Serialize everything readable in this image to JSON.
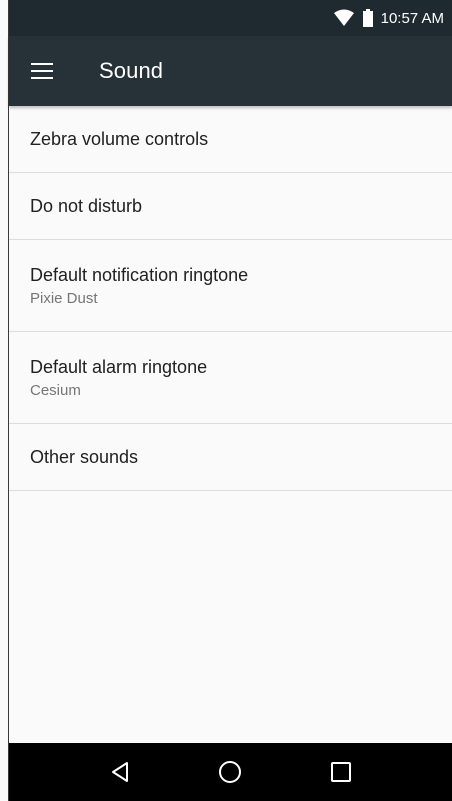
{
  "status_bar": {
    "time": "10:57 AM",
    "icons": [
      "wifi-icon",
      "battery-icon"
    ]
  },
  "toolbar": {
    "menu_icon": "menu-icon",
    "title": "Sound"
  },
  "items": [
    {
      "title": "Zebra volume controls",
      "summary": ""
    },
    {
      "title": "Do not disturb",
      "summary": ""
    },
    {
      "title": "Default notification ringtone",
      "summary": "Pixie Dust"
    },
    {
      "title": "Default alarm ringtone",
      "summary": "Cesium"
    },
    {
      "title": "Other sounds",
      "summary": ""
    }
  ],
  "nav_bar": {
    "icons": [
      "back-icon",
      "home-icon",
      "recents-icon"
    ]
  },
  "colors": {
    "toolbar": "#263238",
    "status_bar": "#1f2a30",
    "background": "#fafafa",
    "nav_bar": "#000000"
  }
}
